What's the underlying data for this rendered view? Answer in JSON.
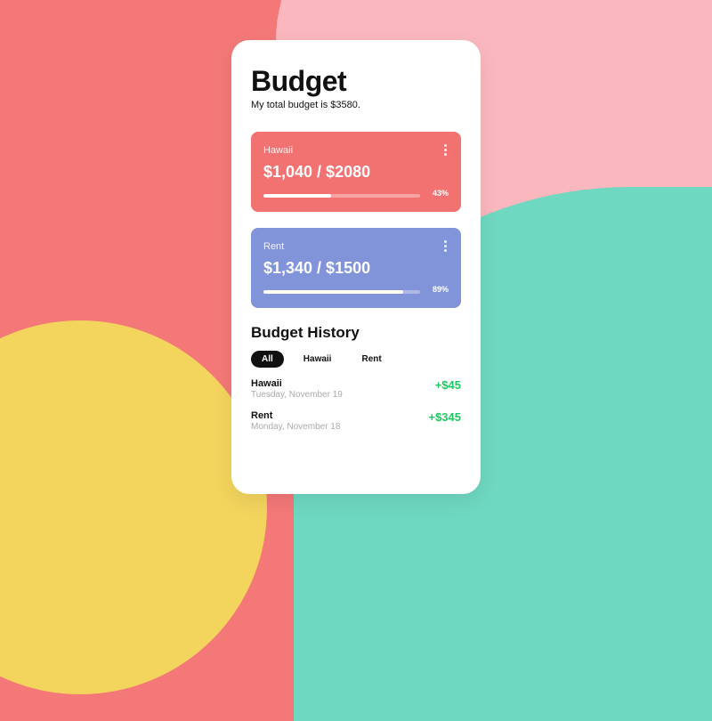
{
  "header": {
    "title": "Budget",
    "subtitle": "My total budget is $3580."
  },
  "cards": [
    {
      "name": "Hawaii",
      "amount_text": "$1,040 / $2080",
      "percent_label": "43%",
      "percent_fill": 43,
      "color": "card-red"
    },
    {
      "name": "Rent",
      "amount_text": "$1,340 / $1500",
      "percent_label": "89%",
      "percent_fill": 89,
      "color": "card-blue"
    }
  ],
  "history": {
    "title": "Budget History",
    "tabs": [
      {
        "label": "All",
        "active": true
      },
      {
        "label": "Hawaii",
        "active": false
      },
      {
        "label": "Rent",
        "active": false
      }
    ],
    "items": [
      {
        "name": "Hawaii",
        "date": "Tuesday, November 19",
        "amount": "+$45"
      },
      {
        "name": "Rent",
        "date": "Monday, November 18",
        "amount": "+$345"
      }
    ]
  }
}
